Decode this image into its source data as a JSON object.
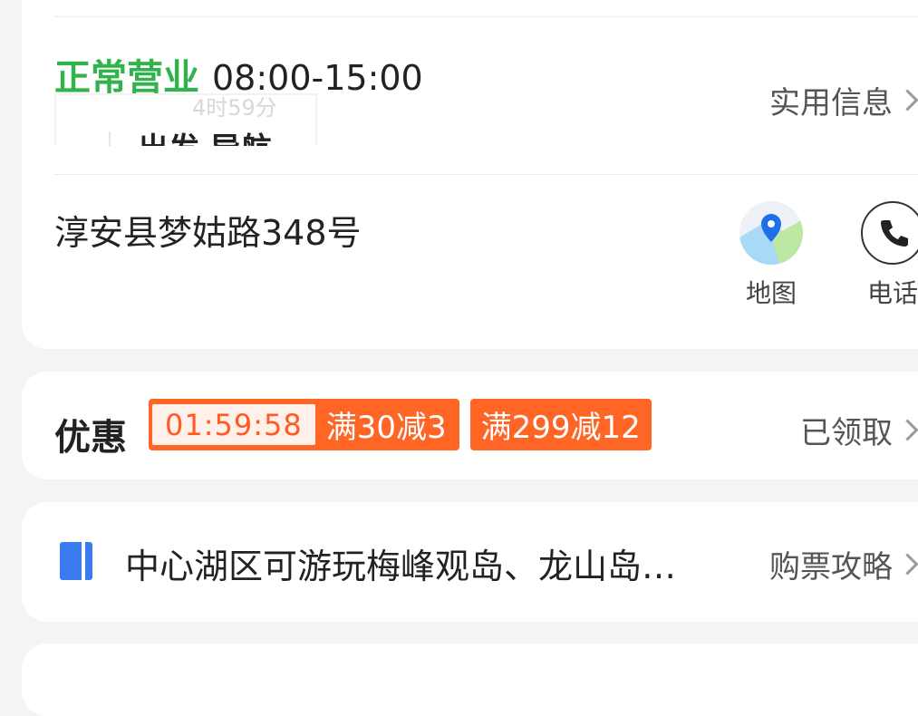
{
  "info": {
    "status": "正常营业",
    "hours": "08:00-15:00",
    "useful_info": "实用信息",
    "faded_widget": {
      "time": "4时59分",
      "text": "出发 导航"
    },
    "address": "淳安县梦姑路348号",
    "map_label": "地图",
    "phone_label": "电话"
  },
  "coupon": {
    "title": "优惠",
    "timer": "01:59:58",
    "tag1": "满30减3",
    "tag2": "满299减12",
    "claimed": "已领取"
  },
  "tip": {
    "text": "中心湖区可游玩梅峰观岛、龙山岛…",
    "link": "购票攻略"
  },
  "colors": {
    "status_green": "#2fb34a",
    "coupon_orange": "#ff6626",
    "book_blue": "#3a7bef"
  }
}
